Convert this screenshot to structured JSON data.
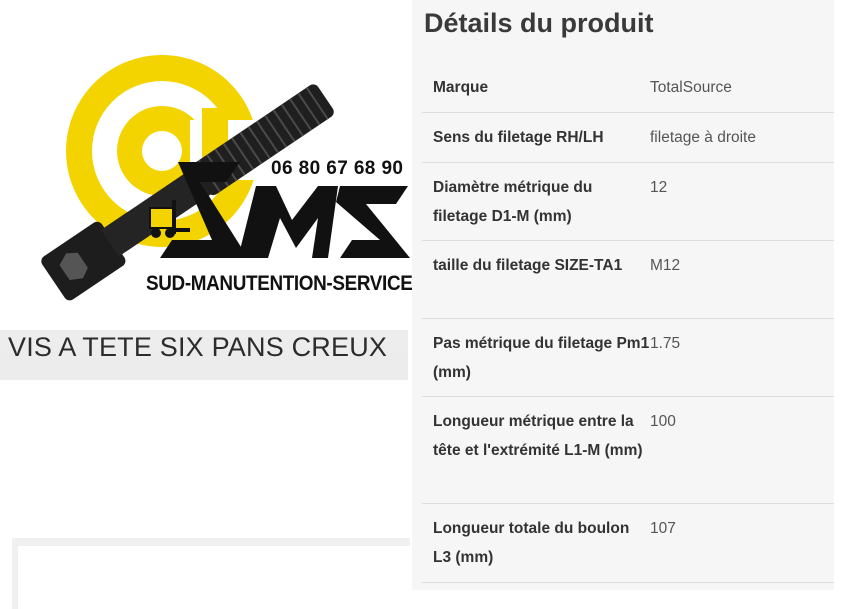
{
  "product": {
    "title": "VIS A TETE SIX PANS CREUX",
    "logo": {
      "brand_letters": "SMS",
      "phone": "06 80 67 68 90",
      "company": "SUD-MANUTENTION-SERVICE"
    }
  },
  "details": {
    "title": "Détails du produit",
    "rows": [
      {
        "label": "Marque",
        "value": "TotalSource"
      },
      {
        "label": "Sens du filetage RH/LH",
        "value": "filetage à droite"
      },
      {
        "label": "Diamètre métrique du filetage D1-M (mm)",
        "value": "12"
      },
      {
        "label": "taille du filetage SIZE-TA1",
        "value": "M12"
      },
      {
        "label": "Pas métrique du filetage Pm1 (mm)",
        "value": "1.75"
      },
      {
        "label": "Longueur métrique entre la tête et l'extrémité L1-M (mm)",
        "value": "100"
      },
      {
        "label": "Longueur totale du boulon L3 (mm)",
        "value": "107"
      }
    ]
  },
  "colors": {
    "logo_yellow": "#f3d400",
    "bolt_dark": "#1e1e1e",
    "panel_bg": "#f6f6f6"
  }
}
